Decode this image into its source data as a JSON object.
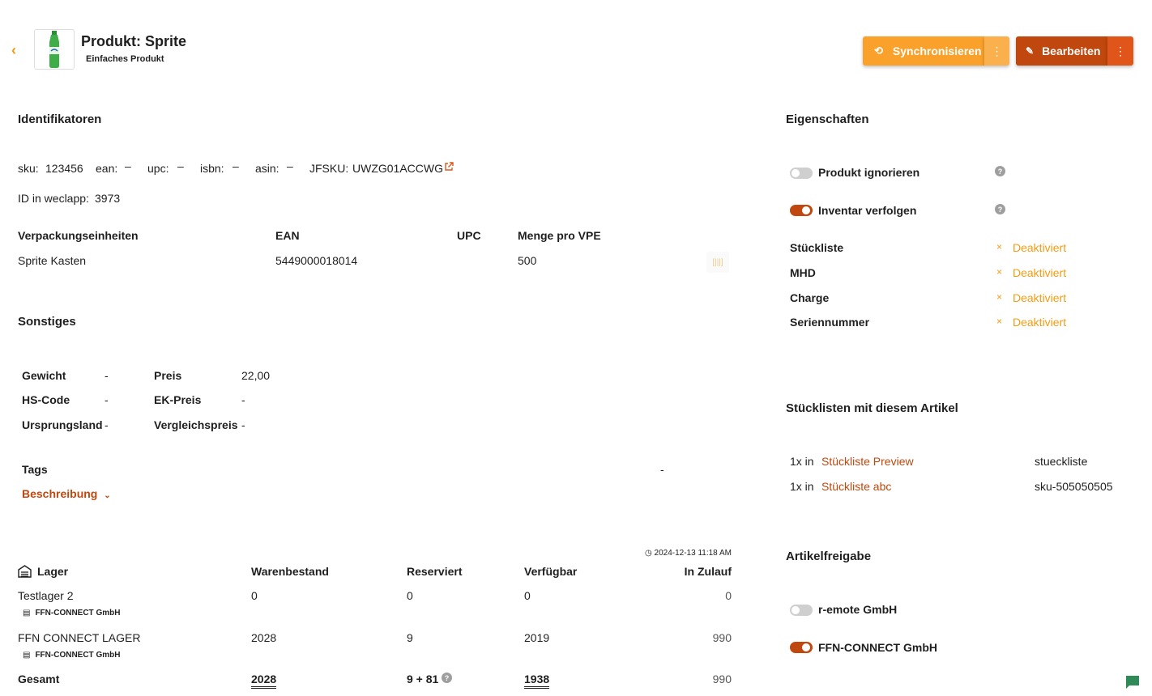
{
  "header": {
    "title": "Produkt: Sprite",
    "subtitle": "Einfaches Produkt",
    "sync_label": "Synchronisieren",
    "edit_label": "Bearbeiten"
  },
  "identifiers": {
    "heading": "Identifikatoren",
    "sku_label": "sku:",
    "sku_value": "123456",
    "ean_label": "ean:",
    "ean_value": "–",
    "upc_label": "upc:",
    "upc_value": "–",
    "isbn_label": "isbn:",
    "isbn_value": "–",
    "asin_label": "asin:",
    "asin_value": "–",
    "jfsku_label": "JFSKU:",
    "jfsku_value": "UWZG01ACCWG",
    "id_label": "ID in weclapp:",
    "id_value": "3973"
  },
  "packaging": {
    "headers": [
      "Verpackungseinheiten",
      "EAN",
      "UPC",
      "Menge pro VPE"
    ],
    "rows": [
      {
        "name": "Sprite Kasten",
        "ean": "5449000018014",
        "upc": "",
        "qty": "500"
      }
    ]
  },
  "misc": {
    "heading": "Sonstiges",
    "weight_label": "Gewicht",
    "weight_value": "-",
    "hs_label": "HS-Code",
    "hs_value": "-",
    "origin_label": "Ursprungsland",
    "origin_value": "-",
    "price_label": "Preis",
    "price_value": "22,00",
    "ek_label": "EK-Preis",
    "ek_value": "-",
    "compare_label": "Vergleichspreis",
    "compare_value": "-",
    "tags_label": "Tags",
    "tags_value": "-",
    "description_label": "Beschreibung"
  },
  "stock": {
    "timestamp": "2024-12-13 11:18 AM",
    "headers": {
      "lager": "Lager",
      "warenbestand": "Warenbestand",
      "reserviert": "Reserviert",
      "verfuegbar": "Verfügbar",
      "zulauf": "In Zulauf"
    },
    "rows": [
      {
        "name": "Testlager 2",
        "owner": "FFN-CONNECT GmbH",
        "bestand": "0",
        "reserviert": "0",
        "verfuegbar": "0",
        "zulauf": "0"
      },
      {
        "name": "FFN CONNECT LAGER",
        "owner": "FFN-CONNECT GmbH",
        "bestand": "2028",
        "reserviert": "9",
        "verfuegbar": "2019",
        "zulauf": "990"
      }
    ],
    "total": {
      "label": "Gesamt",
      "bestand": "2028",
      "reserviert": "9 + 81",
      "verfuegbar": "1938",
      "zulauf": "990"
    }
  },
  "properties": {
    "heading": "Eigenschaften",
    "ignore_label": "Produkt ignorieren",
    "ignore_on": false,
    "inventory_label": "Inventar verfolgen",
    "inventory_on": true,
    "items": [
      {
        "label": "Stückliste",
        "status": "Deaktiviert"
      },
      {
        "label": "MHD",
        "status": "Deaktiviert"
      },
      {
        "label": "Charge",
        "status": "Deaktiviert"
      },
      {
        "label": "Seriennummer",
        "status": "Deaktiviert"
      }
    ]
  },
  "bom": {
    "heading": "Stücklisten mit diesem Artikel",
    "rows": [
      {
        "qty": "1x in",
        "link": "Stückliste Preview",
        "sku": "stueckliste"
      },
      {
        "qty": "1x in",
        "link": "Stückliste abc",
        "sku": "sku-505050505"
      }
    ]
  },
  "release": {
    "heading": "Artikelfreigabe",
    "items": [
      {
        "label": "r-emote GmbH",
        "on": false
      },
      {
        "label": "FFN-CONNECT GmbH",
        "on": true
      }
    ]
  },
  "colors": {
    "accent": "#f39c12",
    "primary": "#c0470d",
    "sync_button": "#f9a12b"
  }
}
